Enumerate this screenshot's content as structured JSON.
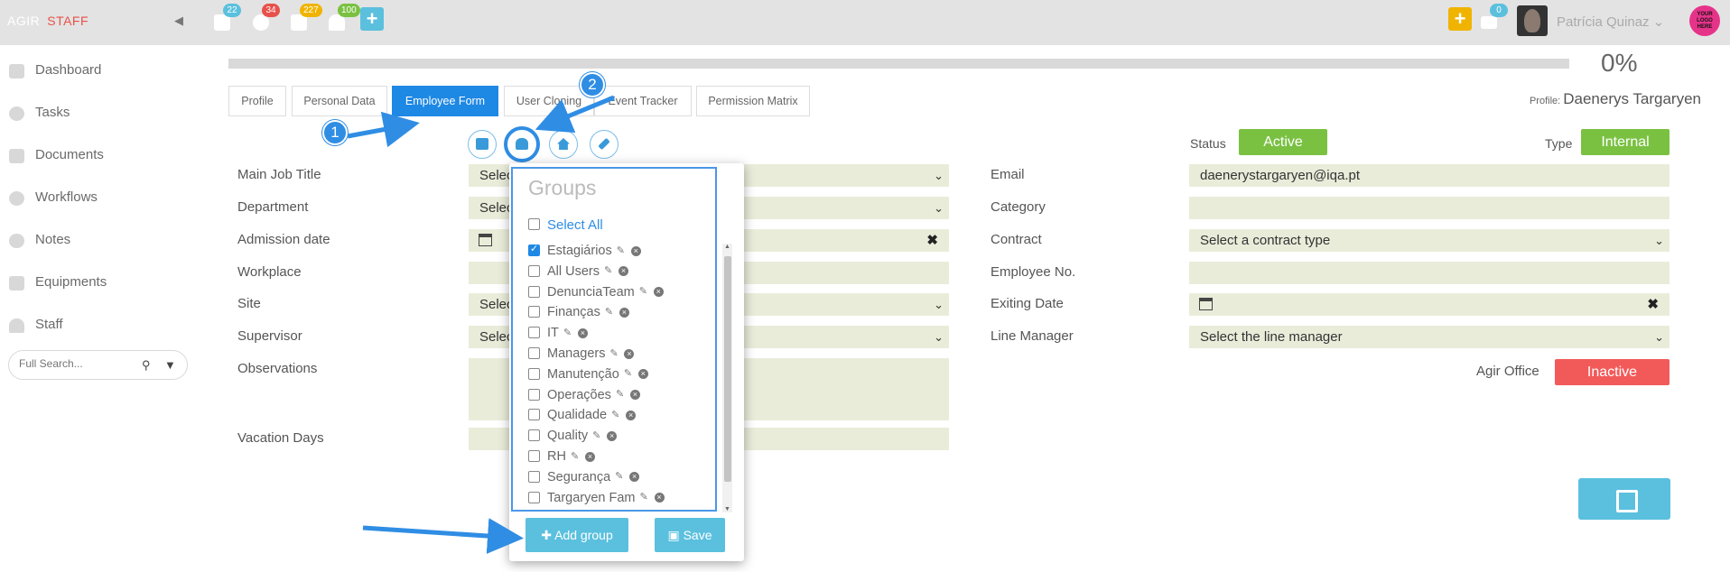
{
  "topbar": {
    "brand_left": "AGIR",
    "brand_right": "STAFF",
    "badges": {
      "calendar": "22",
      "settings": "34",
      "documents": "227",
      "notifications": "100",
      "messages": "0"
    },
    "user_name": "Patrícia Quinaz",
    "logo_text": "YOUR LOGO HERE",
    "colors": {
      "cyan": "#5bc0de",
      "red": "#e8514a",
      "yellow": "#f0b400",
      "green": "#7ac142",
      "orange": "#f5a623"
    }
  },
  "sidebar": {
    "items": [
      {
        "label": "Dashboard",
        "icon": "home-icon"
      },
      {
        "label": "Tasks",
        "icon": "gear-icon"
      },
      {
        "label": "Documents",
        "icon": "document-icon"
      },
      {
        "label": "Workflows",
        "icon": "workflow-icon"
      },
      {
        "label": "Notes",
        "icon": "comment-icon"
      },
      {
        "label": "Equipments",
        "icon": "wrench-icon"
      },
      {
        "label": "Staff",
        "icon": "user-icon"
      }
    ],
    "search_placeholder": "Full Search..."
  },
  "progress": {
    "value": 0,
    "label": "0%"
  },
  "tabs": [
    "Profile",
    "Personal Data",
    "Employee Form",
    "User Cloning",
    "Event Tracker",
    "Permission Matrix"
  ],
  "active_tab": "Employee Form",
  "profile": {
    "prefix": "Profile:",
    "name": "Daenerys Targaryen"
  },
  "form": {
    "left": {
      "main_job_title": "Main Job Title",
      "department": "Department",
      "admission_date": "Admission date",
      "workplace": "Workplace",
      "site": "Site",
      "supervisor": "Supervisor",
      "observations": "Observations",
      "vacation_days": "Vacation Days",
      "select_prefix": "Selec"
    },
    "right": {
      "status_label": "Status",
      "status_value": "Active",
      "type_label": "Type",
      "type_value": "Internal",
      "email_label": "Email",
      "email_value": "daenerystargaryen@iqa.pt",
      "category_label": "Category",
      "contract_label": "Contract",
      "contract_value": "Select a contract type",
      "employee_no_label": "Employee No.",
      "exiting_date_label": "Exiting Date",
      "line_manager_label": "Line Manager",
      "line_manager_value": "Select the line manager",
      "agir_office_label": "Agir Office",
      "agir_office_value": "Inactive"
    }
  },
  "groups_popup": {
    "title": "Groups",
    "select_all": "Select All",
    "items": [
      {
        "label": "Estagiários",
        "checked": true
      },
      {
        "label": "All Users",
        "checked": false
      },
      {
        "label": "DenunciaTeam",
        "checked": false
      },
      {
        "label": "Finanças",
        "checked": false
      },
      {
        "label": "IT",
        "checked": false
      },
      {
        "label": "Managers",
        "checked": false
      },
      {
        "label": "Manutenção",
        "checked": false
      },
      {
        "label": "Operações",
        "checked": false
      },
      {
        "label": "Qualidade",
        "checked": false
      },
      {
        "label": "Quality",
        "checked": false
      },
      {
        "label": "RH",
        "checked": false
      },
      {
        "label": "Segurança",
        "checked": false
      },
      {
        "label": "Targaryen Fam",
        "checked": false
      }
    ],
    "add_group_label": "Add group",
    "save_label": "Save"
  },
  "annotations": {
    "step1": "1",
    "step2": "2"
  }
}
